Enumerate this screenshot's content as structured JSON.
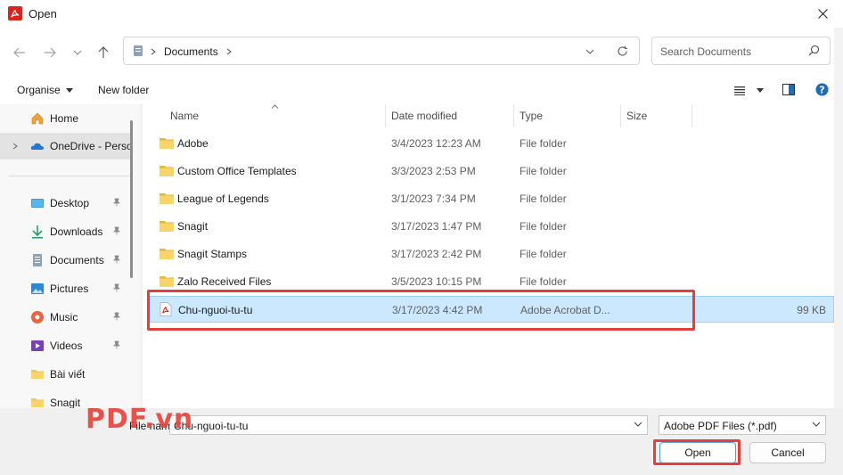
{
  "window": {
    "title": "Open"
  },
  "address": {
    "crumbs": [
      "Documents"
    ]
  },
  "search": {
    "placeholder": "Search Documents"
  },
  "toolbar": {
    "organise": "Organise",
    "new_folder": "New folder"
  },
  "sidebar": {
    "items": [
      {
        "label": "Home"
      },
      {
        "label": "OneDrive - Perso"
      },
      {
        "label": "Desktop"
      },
      {
        "label": "Downloads"
      },
      {
        "label": "Documents"
      },
      {
        "label": "Pictures"
      },
      {
        "label": "Music"
      },
      {
        "label": "Videos"
      },
      {
        "label": "Bài viết"
      },
      {
        "label": "Snagit"
      }
    ]
  },
  "columns": {
    "name": "Name",
    "date": "Date modified",
    "type": "Type",
    "size": "Size"
  },
  "files": [
    {
      "name": "Adobe",
      "date": "3/4/2023 12:23 AM",
      "type": "File folder",
      "size": ""
    },
    {
      "name": "Custom Office Templates",
      "date": "3/3/2023 2:53 PM",
      "type": "File folder",
      "size": ""
    },
    {
      "name": "League of Legends",
      "date": "3/1/2023 7:34 PM",
      "type": "File folder",
      "size": ""
    },
    {
      "name": "Snagit",
      "date": "3/17/2023 1:47 PM",
      "type": "File folder",
      "size": ""
    },
    {
      "name": "Snagit Stamps",
      "date": "3/17/2023 2:42 PM",
      "type": "File folder",
      "size": ""
    },
    {
      "name": "Zalo Received Files",
      "date": "3/5/2023 10:15 PM",
      "type": "File folder",
      "size": ""
    },
    {
      "name": "Chu-nguoi-tu-tu",
      "date": "3/17/2023 4:42 PM",
      "type": "Adobe Acrobat D...",
      "size": "99 KB"
    }
  ],
  "bottom": {
    "file_name_label": "File name:",
    "file_name_value": "Chu-nguoi-tu-tu",
    "filter": "Adobe PDF Files (*.pdf)",
    "open": "Open",
    "cancel": "Cancel"
  },
  "watermark": "PDF.vn",
  "colors": {
    "accent": "#0067c0",
    "selection": "#cce8ff",
    "highlight": "#e0413f",
    "folder": "#f2c74f",
    "pdf": "#d7261e"
  }
}
